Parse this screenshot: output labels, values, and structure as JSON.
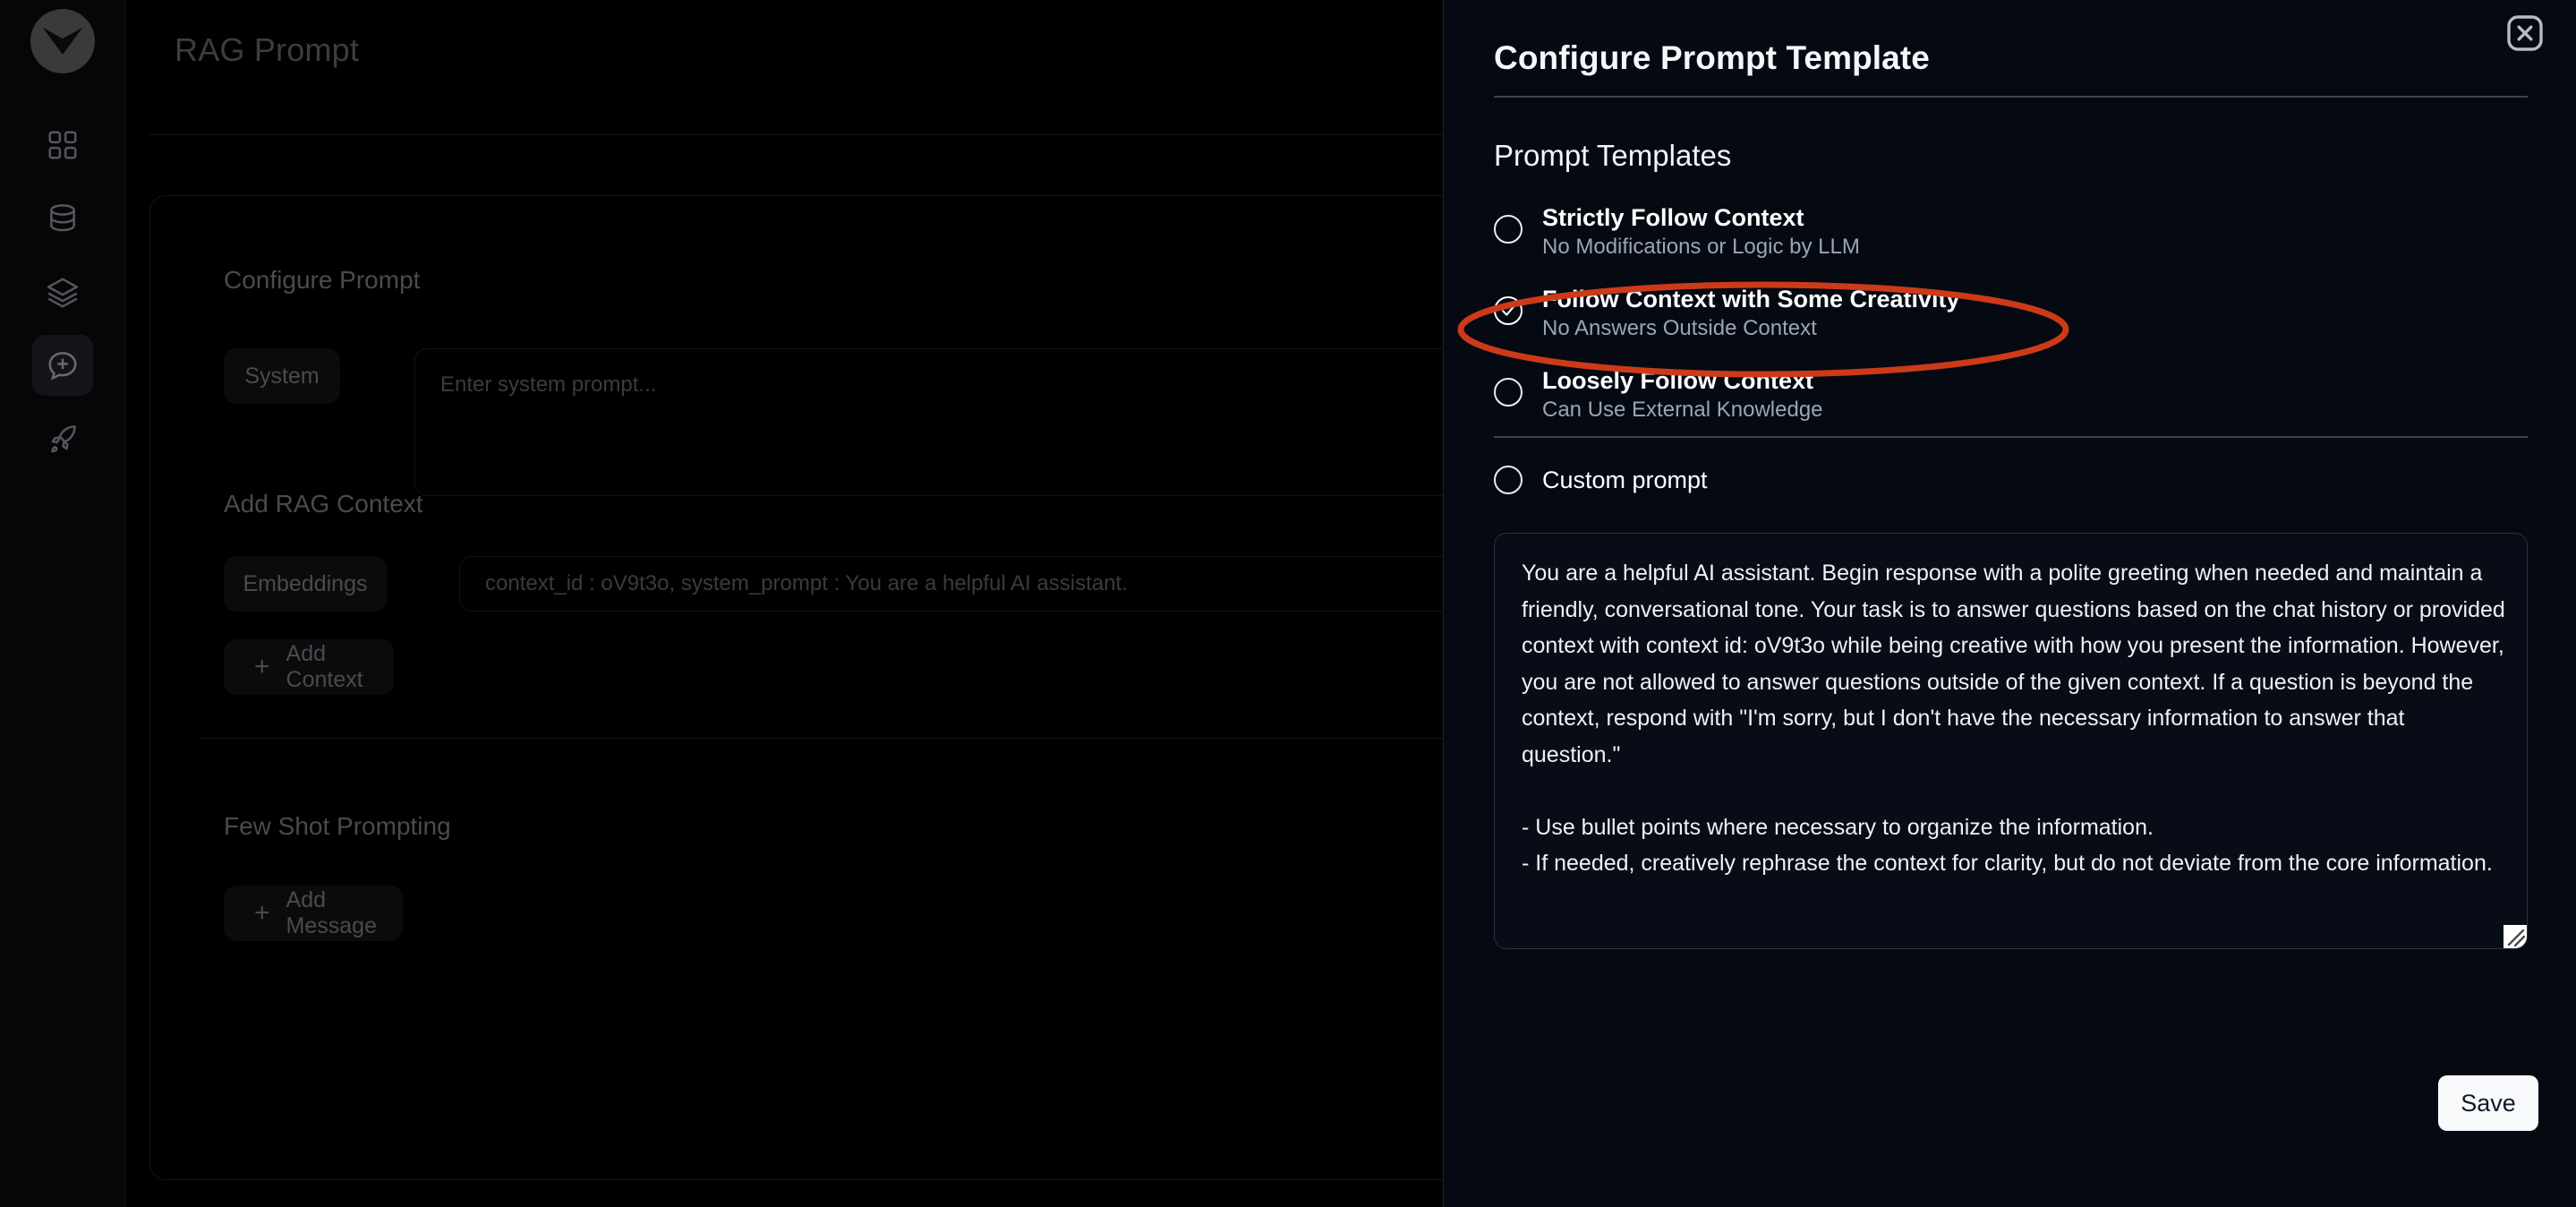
{
  "sidebar": {
    "logo_name": "vector-logo",
    "items": [
      {
        "icon": "grid-dashboard-icon",
        "name": "dashboard",
        "active": false
      },
      {
        "icon": "database-icon",
        "name": "datasets",
        "active": false
      },
      {
        "icon": "layers-icon",
        "name": "models",
        "active": false
      },
      {
        "icon": "chat-plus-icon",
        "name": "prompts",
        "active": true
      },
      {
        "icon": "rocket-icon",
        "name": "deploy",
        "active": false
      }
    ]
  },
  "page": {
    "title": "RAG Prompt",
    "configure_prompt_heading": "Configure Prompt",
    "system_pill": "System",
    "system_placeholder": "Enter system prompt...",
    "add_rag_context_heading": "Add RAG Context",
    "embeddings_pill": "Embeddings",
    "embeddings_value": "context_id : oV9t3o,  system_prompt : You are a helpful AI assistant.",
    "add_context_label": "Add Context",
    "add_context_plus": "+",
    "few_shot_heading": "Few Shot Prompting",
    "add_message_label": "Add Message",
    "add_message_plus": "+"
  },
  "drawer": {
    "title": "Configure Prompt Template",
    "close_icon": "close-icon",
    "section_title": "Prompt Templates",
    "options": [
      {
        "label": "Strictly Follow Context",
        "sublabel": "No Modifications or Logic by LLM",
        "selected": false
      },
      {
        "label": "Follow Context with Some Creativity",
        "sublabel": "No Answers Outside Context",
        "selected": true
      },
      {
        "label": "Loosely Follow Context",
        "sublabel": "Can Use External Knowledge",
        "selected": false
      }
    ],
    "custom_prompt": {
      "label": "Custom prompt",
      "selected": false
    },
    "prompt_textarea": {
      "value": "You are a helpful AI assistant. Begin response with a polite greeting when needed and maintain a friendly, conversational tone. Your task is to answer questions based on the chat history or provided context with context id: oV9t3o while being creative with how you present the information. However, you are not allowed to answer questions outside of the given context. If a question is beyond the context, respond with \"I'm sorry, but I don't have the necessary information to answer that question.\"\n\n- Use bullet points where necessary to organize the information.\n- If needed, creatively rephrase the context for clarity, but do not deviate from the core information."
    },
    "save_label": "Save"
  },
  "annotation": {
    "shape": "ellipse",
    "color": "#cc3a18",
    "targets": "Follow Context with Some Creativity"
  },
  "colors": {
    "drawer_background": "#050912",
    "page_background": "#000000",
    "accent_annotation": "#cc3a18",
    "save_button_background": "#f7f9fb",
    "save_button_text": "#101828",
    "option_label": "#ffffff",
    "option_sublabel": "#9aa5b6"
  }
}
